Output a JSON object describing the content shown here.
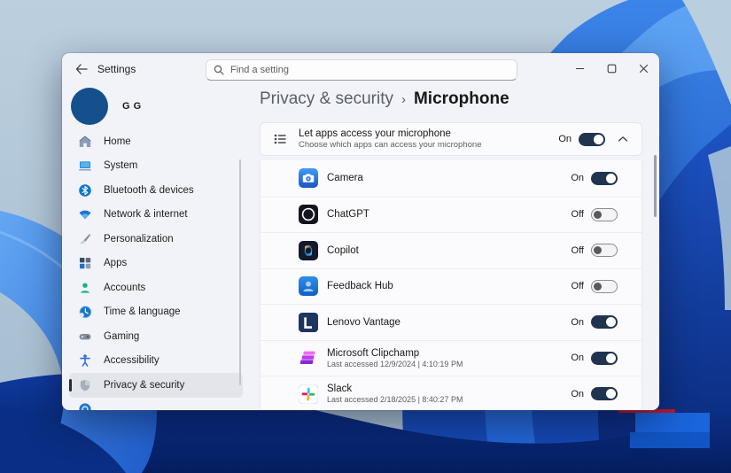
{
  "titlebar": {
    "title": "Settings",
    "back_icon": "back-arrow",
    "minimize_icon": "minimize",
    "maximize_icon": "maximize",
    "close_icon": "close"
  },
  "search": {
    "placeholder": "Find a setting"
  },
  "account": {
    "name": "G G"
  },
  "sidebar": {
    "items": [
      {
        "label": "Home",
        "icon": "home-icon",
        "selected": false
      },
      {
        "label": "System",
        "icon": "system-icon",
        "selected": false
      },
      {
        "label": "Bluetooth & devices",
        "icon": "bluetooth-icon",
        "selected": false
      },
      {
        "label": "Network & internet",
        "icon": "network-icon",
        "selected": false
      },
      {
        "label": "Personalization",
        "icon": "personalization-icon",
        "selected": false
      },
      {
        "label": "Apps",
        "icon": "apps-icon",
        "selected": false
      },
      {
        "label": "Accounts",
        "icon": "accounts-icon",
        "selected": false
      },
      {
        "label": "Time & language",
        "icon": "time-language-icon",
        "selected": false
      },
      {
        "label": "Gaming",
        "icon": "gaming-icon",
        "selected": false
      },
      {
        "label": "Accessibility",
        "icon": "accessibility-icon",
        "selected": false
      },
      {
        "label": "Privacy & security",
        "icon": "privacy-security-icon",
        "selected": true
      },
      {
        "label": "",
        "icon": "windows-update-icon",
        "selected": false
      }
    ]
  },
  "main": {
    "breadcrumb": {
      "parent": "Privacy & security",
      "separator": "›",
      "current": "Microphone"
    },
    "master_toggle": {
      "title": "Let apps access your microphone",
      "subtitle": "Choose which apps can access your microphone",
      "state_label": "On",
      "on": true,
      "icon": "app-permission-list-icon",
      "expander_icon": "chevron-up"
    },
    "apps": [
      {
        "name": "Camera",
        "icon": "camera-app-icon",
        "state_label": "On",
        "on": true
      },
      {
        "name": "ChatGPT",
        "icon": "chatgpt-app-icon",
        "state_label": "Off",
        "on": false
      },
      {
        "name": "Copilot",
        "icon": "copilot-app-icon",
        "state_label": "Off",
        "on": false
      },
      {
        "name": "Feedback Hub",
        "icon": "feedback-hub-app-icon",
        "state_label": "Off",
        "on": false
      },
      {
        "name": "Lenovo Vantage",
        "icon": "lenovo-vantage-app-icon",
        "state_label": "On",
        "on": true
      },
      {
        "name": "Microsoft Clipchamp",
        "icon": "clipchamp-app-icon",
        "subtitle": "Last accessed 12/9/2024  |  4:10:19 PM",
        "state_label": "On",
        "on": true
      },
      {
        "name": "Slack",
        "icon": "slack-app-icon",
        "subtitle": "Last accessed 2/18/2025  |  8:40:27 PM",
        "state_label": "On",
        "on": true
      }
    ]
  },
  "colors": {
    "toggle_on_accent": "#20344f",
    "avatar_blue": "#15508c",
    "window_background": "#f1f3f8",
    "card_background": "#fbfbfd",
    "wallpaper_bright_blue": "#2f7ae6",
    "wallpaper_dark_navy": "#071f60",
    "wallpaper_silver": "#b9cede"
  }
}
